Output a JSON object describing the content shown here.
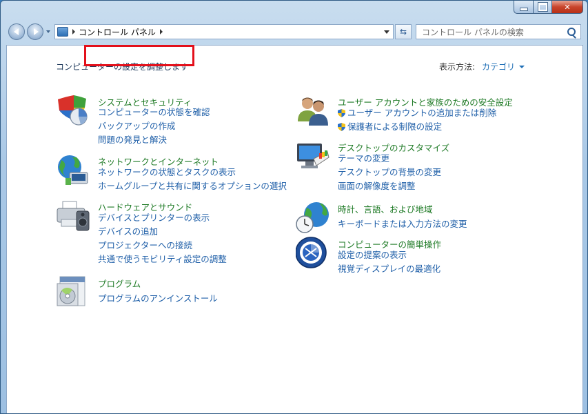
{
  "window": {
    "breadcrumb": "コントロール パネル",
    "search_placeholder": "コントロール パネルの検索"
  },
  "content": {
    "subtitle": "コンピューターの設定を調整します",
    "view_by_label": "表示方法:",
    "view_by_value": "カテゴリ"
  },
  "categories": [
    {
      "title": "システムとセキュリティ",
      "icon": "shield-chart-icon",
      "links": [
        "コンピューターの状態を確認",
        "バックアップの作成",
        "問題の発見と解決"
      ]
    },
    {
      "title": "ネットワークとインターネット",
      "icon": "network-globe-icon",
      "links": [
        "ネットワークの状態とタスクの表示",
        "ホームグループと共有に関するオプションの選択"
      ]
    },
    {
      "title": "ハードウェアとサウンド",
      "icon": "printer-speaker-icon",
      "links": [
        "デバイスとプリンターの表示",
        "デバイスの追加",
        "プロジェクターへの接続",
        "共通で使うモビリティ設定の調整"
      ]
    },
    {
      "title": "プログラム",
      "icon": "programs-disc-icon",
      "links": [
        "プログラムのアンインストール"
      ]
    },
    {
      "title": "ユーザー アカウントと家族のための安全設定",
      "icon": "users-icon",
      "links": [
        "ユーザー アカウントの追加または削除",
        "保護者による制限の設定"
      ]
    },
    {
      "title": "デスクトップのカスタマイズ",
      "icon": "monitor-palette-icon",
      "links": [
        "テーマの変更",
        "デスクトップの背景の変更",
        "画面の解像度を調整"
      ]
    },
    {
      "title": "時計、言語、および地域",
      "icon": "clock-globe-icon",
      "links": [
        "キーボードまたは入力方法の変更"
      ]
    },
    {
      "title": "コンピューターの簡単操作",
      "icon": "ease-of-access-icon",
      "links": [
        "設定の提案の表示",
        "視覚ディスプレイの最適化"
      ]
    }
  ],
  "colors": {
    "category_title": "#1e7a25",
    "link": "#1f5fa8",
    "highlight": "#e3101b"
  }
}
